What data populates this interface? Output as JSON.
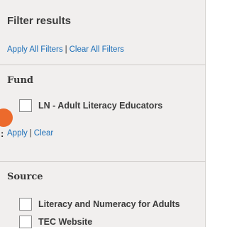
{
  "panel": {
    "title": "Filter results",
    "apply_all_label": "Apply All Filters",
    "separator": "|",
    "clear_all_label": "Clear All Filters"
  },
  "fund": {
    "title": "Fund",
    "options": [
      "LN - Adult Literacy Educators"
    ],
    "apply_label": "Apply",
    "separator": "|",
    "clear_label": "Clear"
  },
  "source": {
    "title": "Source",
    "options": [
      "Literacy and Numeracy for Adults",
      "TEC Website"
    ]
  },
  "cursor_glyph": ":",
  "colors": {
    "panel_bg": "#f1efee",
    "link": "#1d6fb8",
    "marker": "#ec6a2c"
  }
}
